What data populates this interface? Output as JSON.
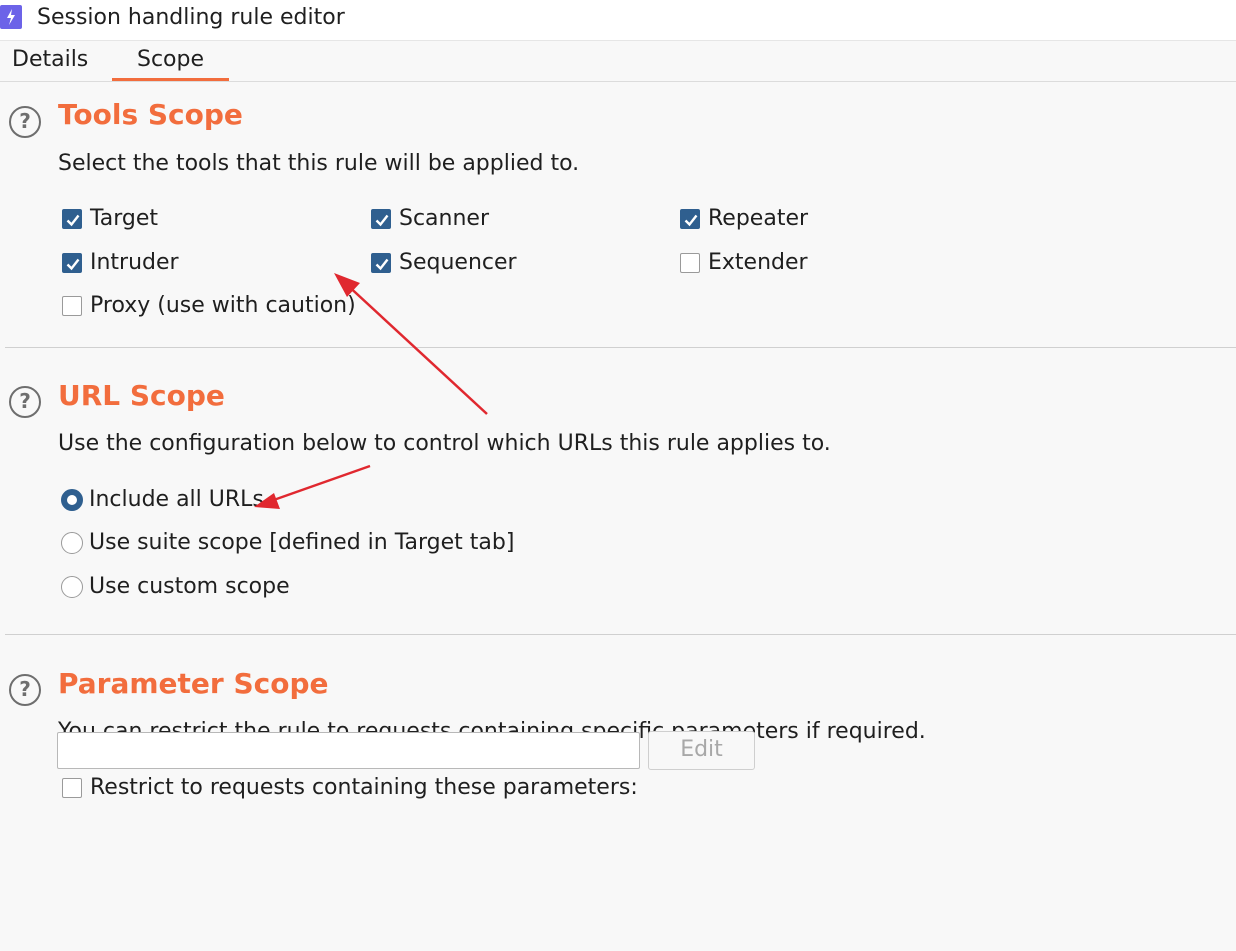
{
  "window": {
    "title": "Session handling rule editor"
  },
  "tabs": [
    {
      "label": "Details",
      "selected": false
    },
    {
      "label": "Scope",
      "selected": true
    }
  ],
  "tools_scope": {
    "title": "Tools Scope",
    "description": "Select the tools that this rule will be applied to.",
    "options": [
      {
        "label": "Target",
        "checked": true
      },
      {
        "label": "Scanner",
        "checked": true
      },
      {
        "label": "Repeater",
        "checked": true
      },
      {
        "label": "Intruder",
        "checked": true
      },
      {
        "label": "Sequencer",
        "checked": true
      },
      {
        "label": "Extender",
        "checked": false
      },
      {
        "label": "Proxy (use with caution)",
        "checked": false
      }
    ]
  },
  "url_scope": {
    "title": "URL Scope",
    "description": "Use the configuration below to control which URLs this rule applies to.",
    "options": [
      {
        "label": "Include all URLs",
        "selected": true
      },
      {
        "label": "Use suite scope [defined in Target tab]",
        "selected": false
      },
      {
        "label": "Use custom scope",
        "selected": false
      }
    ]
  },
  "parameter_scope": {
    "title": "Parameter Scope",
    "description": "You can restrict the rule to requests containing specific parameters if required.",
    "restrict_label": "Restrict to requests containing these parameters:",
    "restrict_checked": false,
    "input_value": "",
    "edit_label": "Edit"
  },
  "colors": {
    "accent": "#f26d3d",
    "checkbox_checked": "#2f5f8f",
    "annotation_arrow": "#e0282f"
  }
}
